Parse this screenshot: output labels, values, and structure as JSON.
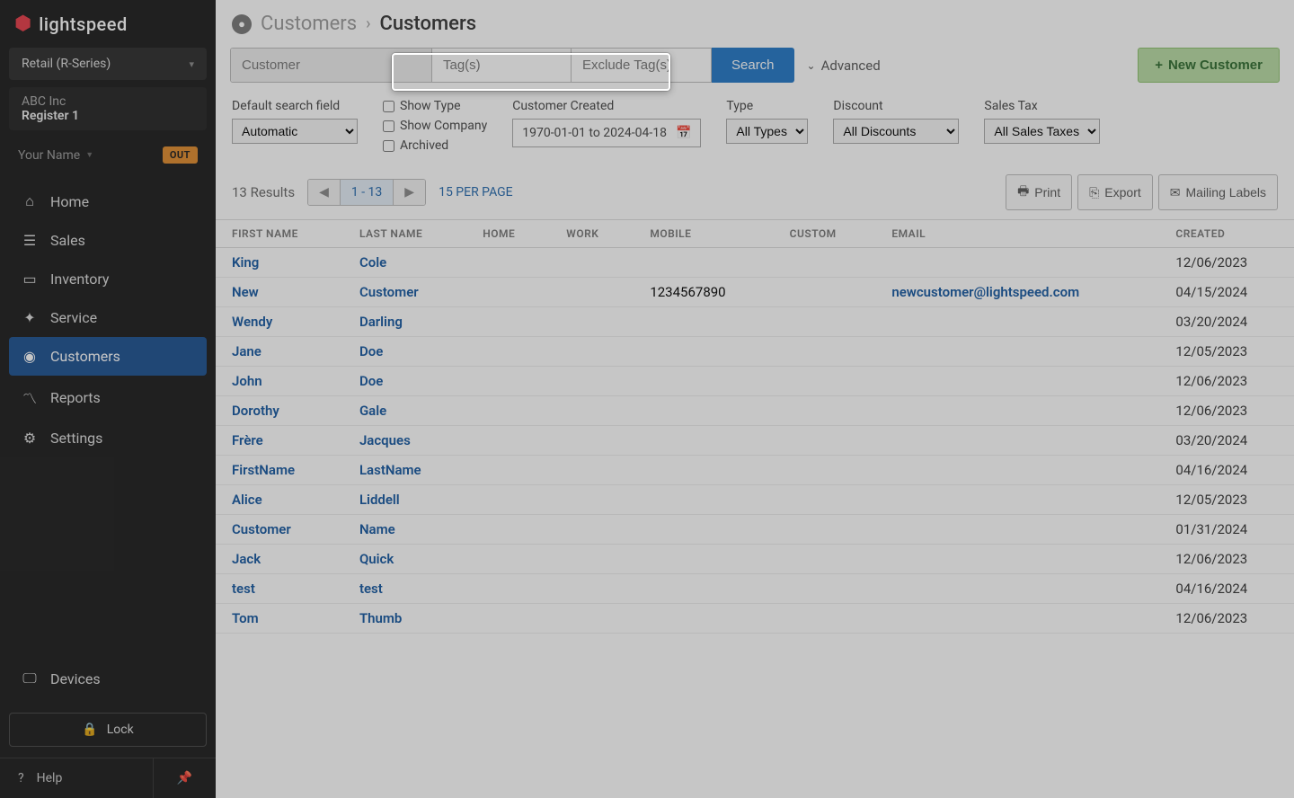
{
  "brand": "lightspeed",
  "retail_selector": "Retail (R-Series)",
  "company": {
    "name": "ABC Inc",
    "register": "Register 1"
  },
  "user": {
    "name": "Your Name",
    "status_badge": "OUT"
  },
  "nav": {
    "home": "Home",
    "sales": "Sales",
    "inventory": "Inventory",
    "service": "Service",
    "customers": "Customers",
    "reports": "Reports",
    "settings": "Settings",
    "devices": "Devices",
    "lock": "Lock",
    "help": "Help"
  },
  "breadcrumb": {
    "parent": "Customers",
    "current": "Customers"
  },
  "search": {
    "customer_placeholder": "Customer",
    "tags_placeholder": "Tag(s)",
    "exclude_placeholder": "Exclude Tag(s)",
    "button": "Search",
    "advanced": "Advanced",
    "new_customer": "New Customer"
  },
  "filters": {
    "default_field_label": "Default search field",
    "default_field_value": "Automatic",
    "show_type": "Show Type",
    "show_company": "Show Company",
    "archived": "Archived",
    "customer_created_label": "Customer Created",
    "date_range": "1970-01-01 to 2024-04-18",
    "type_label": "Type",
    "type_value": "All Types",
    "discount_label": "Discount",
    "discount_value": "All Discounts",
    "salestax_label": "Sales Tax",
    "salestax_value": "All Sales Taxes"
  },
  "results": {
    "count": "13 Results",
    "range": "1 - 13",
    "per_page": "15 PER PAGE",
    "print": "Print",
    "export": "Export",
    "mailing": "Mailing Labels"
  },
  "table": {
    "headers": [
      "FIRST NAME",
      "LAST NAME",
      "HOME",
      "WORK",
      "MOBILE",
      "CUSTOM",
      "EMAIL",
      "CREATED"
    ],
    "rows": [
      {
        "first": "King",
        "last": "Cole",
        "home": "",
        "work": "",
        "mobile": "",
        "custom": "",
        "email": "",
        "created": "12/06/2023"
      },
      {
        "first": "New",
        "last": "Customer",
        "home": "",
        "work": "",
        "mobile": "1234567890",
        "custom": "",
        "email": "newcustomer@lightspeed.com",
        "created": "04/15/2024"
      },
      {
        "first": "Wendy",
        "last": "Darling",
        "home": "",
        "work": "",
        "mobile": "",
        "custom": "",
        "email": "",
        "created": "03/20/2024"
      },
      {
        "first": "Jane",
        "last": "Doe",
        "home": "",
        "work": "",
        "mobile": "",
        "custom": "",
        "email": "",
        "created": "12/05/2023"
      },
      {
        "first": "John",
        "last": "Doe",
        "home": "",
        "work": "",
        "mobile": "",
        "custom": "",
        "email": "",
        "created": "12/06/2023"
      },
      {
        "first": "Dorothy",
        "last": "Gale",
        "home": "",
        "work": "",
        "mobile": "",
        "custom": "",
        "email": "",
        "created": "12/06/2023"
      },
      {
        "first": "Frère",
        "last": "Jacques",
        "home": "",
        "work": "",
        "mobile": "",
        "custom": "",
        "email": "",
        "created": "03/20/2024"
      },
      {
        "first": "FirstName",
        "last": "LastName",
        "home": "",
        "work": "",
        "mobile": "",
        "custom": "",
        "email": "",
        "created": "04/16/2024"
      },
      {
        "first": "Alice",
        "last": "Liddell",
        "home": "",
        "work": "",
        "mobile": "",
        "custom": "",
        "email": "",
        "created": "12/05/2023"
      },
      {
        "first": "Customer",
        "last": "Name",
        "home": "",
        "work": "",
        "mobile": "",
        "custom": "",
        "email": "",
        "created": "01/31/2024"
      },
      {
        "first": "Jack",
        "last": "Quick",
        "home": "",
        "work": "",
        "mobile": "",
        "custom": "",
        "email": "",
        "created": "12/06/2023"
      },
      {
        "first": "test",
        "last": "test",
        "home": "",
        "work": "",
        "mobile": "",
        "custom": "",
        "email": "",
        "created": "04/16/2024"
      },
      {
        "first": "Tom",
        "last": "Thumb",
        "home": "",
        "work": "",
        "mobile": "",
        "custom": "",
        "email": "",
        "created": "12/06/2023"
      }
    ]
  }
}
